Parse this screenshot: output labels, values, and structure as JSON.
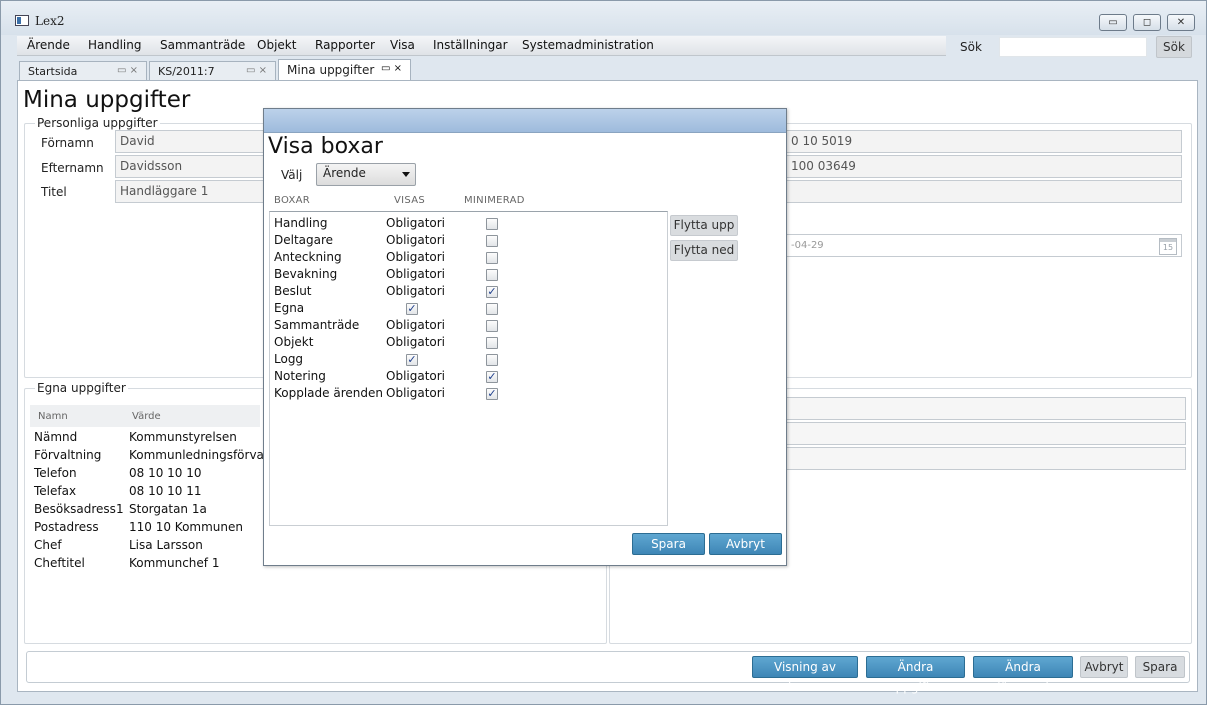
{
  "app": {
    "title": "Lex2"
  },
  "window_controls": {
    "minimize": "▭",
    "maximize": "◻",
    "close": "✕"
  },
  "menu": [
    {
      "label": "Ärende"
    },
    {
      "label": "Handling"
    },
    {
      "label": "Sammanträde"
    },
    {
      "label": "Objekt"
    },
    {
      "label": "Rapporter"
    },
    {
      "label": "Visa"
    },
    {
      "label": "Inställningar"
    },
    {
      "label": "Systemadministration"
    }
  ],
  "search": {
    "label": "Sök",
    "value": "",
    "button": "Sök"
  },
  "tabs": [
    {
      "label": "Startsida",
      "icons": "▭ ×"
    },
    {
      "label": "KS/2011:7",
      "icons": "▭ ×"
    },
    {
      "label": "Mina uppgifter",
      "icons": "▭ ×"
    }
  ],
  "page": {
    "title": "Mina uppgifter",
    "personal": {
      "legend": "Personliga uppgifter",
      "fields": [
        {
          "label": "Förnamn",
          "value": "David"
        },
        {
          "label": "Efternamn",
          "value": "Davidsson"
        },
        {
          "label": "Titel",
          "value": "Handläggare 1"
        }
      ],
      "right_values": [
        "0 10 5019",
        "100 03649",
        ""
      ],
      "date_value": "-04-29",
      "calendar_day": "15"
    },
    "egna": {
      "legend": "Egna uppgifter",
      "headers": {
        "key": "Namn",
        "value": "Värde"
      },
      "rows": [
        {
          "key": "Nämnd",
          "value": "Kommunstyrelsen"
        },
        {
          "key": "Förvaltning",
          "value": "Kommunledningsförval"
        },
        {
          "key": "Telefon",
          "value": "08 10 10 10"
        },
        {
          "key": "Telefax",
          "value": "08 10 10 11"
        },
        {
          "key": "Besöksadress1",
          "value": "Storgatan 1a"
        },
        {
          "key": "Postadress",
          "value": "110 10 Kommunen"
        },
        {
          "key": "Chef",
          "value": "Lisa Larsson"
        },
        {
          "key": "Cheftitel",
          "value": "Kommunchef 1"
        }
      ]
    },
    "buttons": {
      "visning": "Visning av boxar",
      "andra_uppgifter": "Ändra uppgifter",
      "andra_losenord": "Ändra lösenord",
      "avbryt": "Avbryt",
      "spara": "Spara"
    }
  },
  "dialog": {
    "title": "Visa boxar",
    "valj_label": "Välj",
    "valj_value": "Ärende",
    "columns": {
      "boxar": "BOXAR",
      "visas": "VISAS",
      "minimerad": "MINIMERAD"
    },
    "rows": [
      {
        "name": "Handling",
        "visas": "Obligatori",
        "visas_checked": null,
        "minimerad": false
      },
      {
        "name": "Deltagare",
        "visas": "Obligatori",
        "visas_checked": null,
        "minimerad": false
      },
      {
        "name": "Anteckning",
        "visas": "Obligatori",
        "visas_checked": null,
        "minimerad": false
      },
      {
        "name": "Bevakning",
        "visas": "Obligatori",
        "visas_checked": null,
        "minimerad": false
      },
      {
        "name": "Beslut",
        "visas": "Obligatori",
        "visas_checked": null,
        "minimerad": true
      },
      {
        "name": "Egna",
        "visas": "",
        "visas_checked": true,
        "minimerad": false
      },
      {
        "name": "Sammanträde",
        "visas": "Obligatori",
        "visas_checked": null,
        "minimerad": false
      },
      {
        "name": "Objekt",
        "visas": "Obligatori",
        "visas_checked": null,
        "minimerad": false
      },
      {
        "name": "Logg",
        "visas": "",
        "visas_checked": true,
        "minimerad": false
      },
      {
        "name": "Notering",
        "visas": "Obligatori",
        "visas_checked": null,
        "minimerad": true
      },
      {
        "name": "Kopplade ärenden",
        "visas": "Obligatori",
        "visas_checked": null,
        "minimerad": true
      }
    ],
    "flytta_upp": "Flytta upp",
    "flytta_ned": "Flytta ned",
    "spara": "Spara",
    "avbryt": "Avbryt"
  },
  "colors": {
    "accent": "#4a93c4",
    "titlebar": "#a9c3e0"
  }
}
